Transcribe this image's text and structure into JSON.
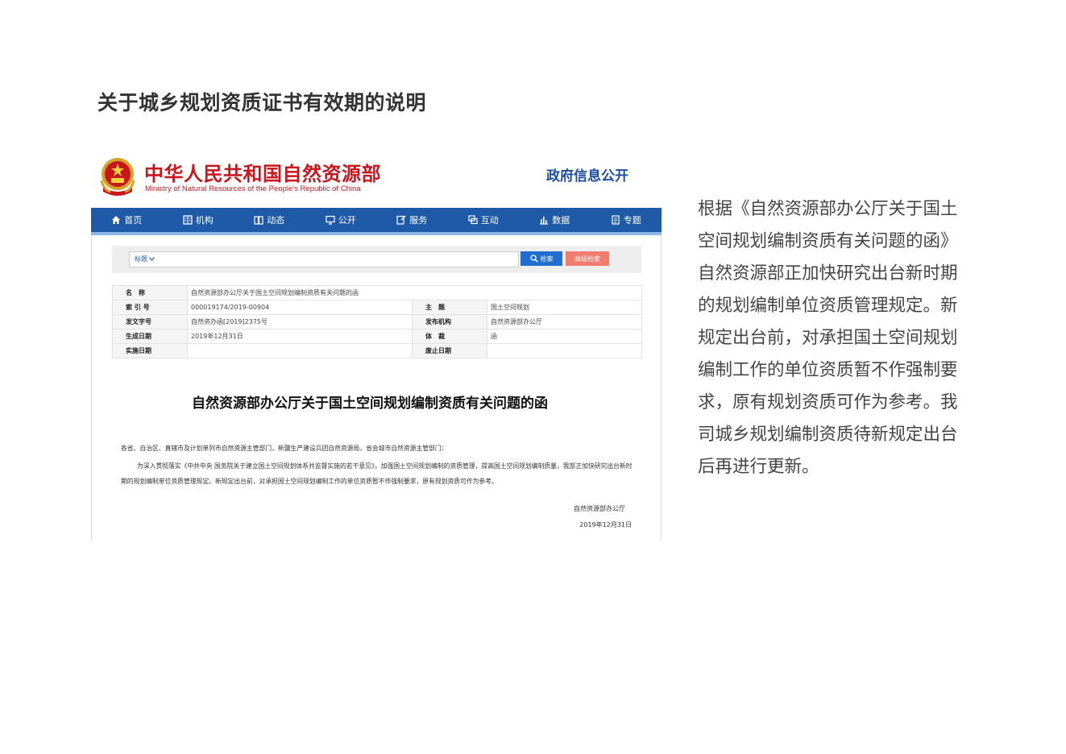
{
  "page": {
    "title": "关于城乡规划资质证书有效期的说明"
  },
  "screenshot": {
    "header": {
      "ministry_cn": "中华人民共和国自然资源部",
      "ministry_en": "Ministry of Natural Resources of the People’s Republic of China",
      "gov_info": "政府信息公开"
    },
    "nav": [
      {
        "label": "首页",
        "icon": "home-icon"
      },
      {
        "label": "机构",
        "icon": "org-icon"
      },
      {
        "label": "动态",
        "icon": "news-icon"
      },
      {
        "label": "公开",
        "icon": "monitor-icon"
      },
      {
        "label": "服务",
        "icon": "edit-icon"
      },
      {
        "label": "互动",
        "icon": "chat-icon"
      },
      {
        "label": "数据",
        "icon": "bar-chart-icon"
      },
      {
        "label": "专题",
        "icon": "document-icon"
      }
    ],
    "search": {
      "select_value": "标题",
      "search_label": "检索",
      "advanced_label": "高级检索"
    },
    "meta": {
      "name_key": "名　称",
      "name_value": "自然资源部办公厅关于国土空间规划编制资质有关问题的函",
      "index_key": "索 引 号",
      "index_value": "000019174/2019-00904",
      "subject_key": "主　题",
      "subject_value": "国土空间规划",
      "docno_key": "发文字号",
      "docno_value": "自然资办函[2019]2375号",
      "issuer_key": "发布机构",
      "issuer_value": "自然资源部办公厅",
      "created_key": "生成日期",
      "created_value": "2019年12月31日",
      "genre_key": "体　裁",
      "genre_value": "函",
      "effective_key": "实施日期",
      "effective_value": "",
      "expiry_key": "废止日期",
      "expiry_value": ""
    },
    "document": {
      "title": "自然资源部办公厅关于国土空间规划编制资质有关问题的函",
      "address": "各省、自治区、直辖市及计划单列市自然资源主管部门，新疆生产建设兵团自然资源局，省会城市自然资源主管部门：",
      "body": "为深入贯彻落实《中共中央 国务院关于建立国土空间规划体系并监督实施的若干意见》，加强国土空间规划编制的资质管理，提高国土空间规划编制质量，我部正加快研究出台新时期的规划编制单位资质管理规定。新规定出台前，对承担国土空间规划编制工作的单位资质暂不作强制要求，原有规划资质可作为参考。",
      "signature": "自然资源部办公厅",
      "date": "2019年12月31日"
    }
  },
  "side_text": "根据《自然资源部办公厅关于国土空间规划编制资质有关问题的函》自然资源部正加快研究出台新时期的规划编制单位资质管理规定。新规定出台前，对承担国土空间规划编制工作的单位资质暂不作强制要求，原有规划资质可作为参考。我司城乡规划编制资质待新规定出台后再进行更新。",
  "colors": {
    "brand_red": "#c8161d",
    "nav_blue": "#1e5aa8",
    "info_blue": "#1e4d9c",
    "search_blue": "#1e6fcf",
    "advanced_red": "#f27c6e"
  }
}
